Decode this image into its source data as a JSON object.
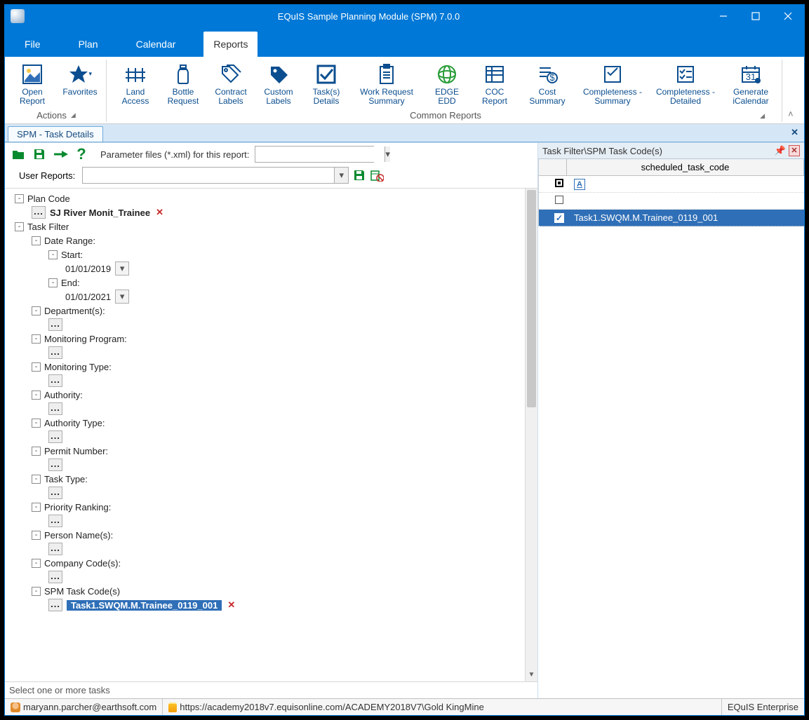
{
  "window": {
    "title": "EQuIS Sample Planning Module (SPM) 7.0.0"
  },
  "menu": {
    "file": "File",
    "plan": "Plan",
    "calendar": "Calendar",
    "reports": "Reports"
  },
  "ribbon": {
    "group_actions": "Actions",
    "group_common": "Common Reports",
    "open_report": "Open Report",
    "favorites": "Favorites",
    "land_access": "Land Access",
    "bottle_request": "Bottle Request",
    "contract_labels": "Contract Labels",
    "custom_labels": "Custom Labels",
    "tasks_details": "Task(s) Details",
    "work_request_summary": "Work Request Summary",
    "edge_edd": "EDGE EDD",
    "coc_report": "COC Report",
    "cost_summary": "Cost Summary",
    "completeness_summary": "Completeness - Summary",
    "completeness_detailed": "Completeness - Detailed",
    "generate_icalendar": "Generate iCalendar"
  },
  "doc_tab": "SPM - Task Details",
  "params_label": "Parameter files (*.xml) for this report:",
  "user_reports_label": "User Reports:",
  "tree": {
    "plan_code": "Plan Code",
    "plan_value": "SJ River Monit_Trainee",
    "task_filter": "Task Filter",
    "date_range": "Date Range:",
    "start": "Start:",
    "start_value": "01/01/2019",
    "end": "End:",
    "end_value": "01/01/2021",
    "departments": "Department(s):",
    "monitoring_program": "Monitoring Program:",
    "monitoring_type": "Monitoring Type:",
    "authority": "Authority:",
    "authority_type": "Authority Type:",
    "permit_number": "Permit Number:",
    "task_type": "Task Type:",
    "priority_ranking": "Priority Ranking:",
    "person_names": "Person Name(s):",
    "company_codes": "Company Code(s):",
    "spm_task_codes": "SPM Task Code(s)",
    "spm_task_value": "Task1.SWQM.M.Trainee_0119_001"
  },
  "status_hint": "Select one or more tasks",
  "taskfilter_panel": {
    "title": "Task Filter\\SPM Task Code(s)",
    "column": "scheduled_task_code",
    "selected_row": "Task1.SWQM.M.Trainee_0119_001"
  },
  "statusbar": {
    "user": "maryann.parcher@earthsoft.com",
    "connection": "https://academy2018v7.equisonline.com/ACADEMY2018V7\\Gold KingMine",
    "product": "EQuIS Enterprise"
  }
}
